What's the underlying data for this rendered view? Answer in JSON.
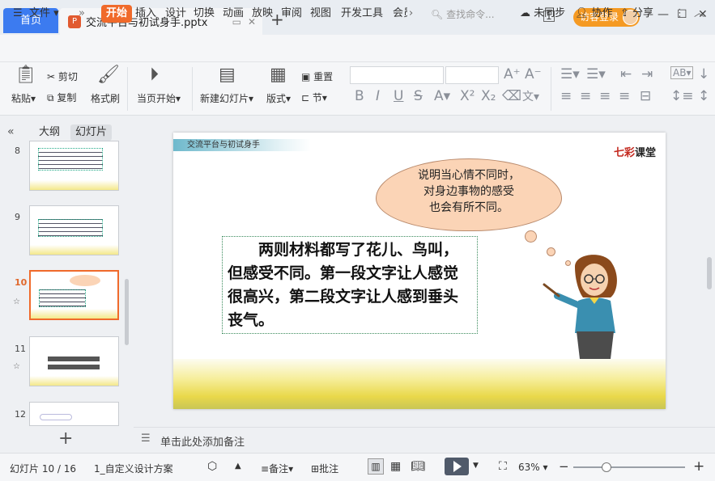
{
  "tabs": {
    "home": "首页",
    "doc": "交流平台与初试身手.pptx"
  },
  "account": {
    "visitor_login": "访客登录"
  },
  "menu": {
    "file": "文件",
    "items": [
      "开始",
      "插入",
      "设计",
      "切换",
      "动画",
      "放映",
      "审阅",
      "视图",
      "开发工具",
      "会员"
    ],
    "search": "查找命令...",
    "sync": "未同步",
    "collab": "协作",
    "share": "分享"
  },
  "ribbon": {
    "paste": "粘贴",
    "cut": "剪切",
    "copy": "复制",
    "format_painter": "格式刷",
    "play_from_current": "当页开始",
    "new_slide": "新建幻灯片",
    "layout": "版式",
    "reset": "重置",
    "section": "节"
  },
  "panel": {
    "outline": "大纲",
    "slides": "幻灯片",
    "numbers": [
      "8",
      "9",
      "10",
      "11",
      "12"
    ]
  },
  "slide": {
    "header": "交流平台与初试身手",
    "logo_a": "七彩",
    "logo_b": "课堂",
    "bubble": [
      "说明当心情不同时，",
      "对身边事物的感受",
      "也会有所不同。"
    ],
    "body": "　　两则材料都写了花儿、鸟叫，但感受不同。第一段文字让人感觉很高兴，第二段文字让人感到垂头丧气。"
  },
  "notes": {
    "placeholder": "单击此处添加备注"
  },
  "status": {
    "slide_pos": "幻灯片 10 / 16",
    "theme": "1_自定义设计方案",
    "notes": "备注",
    "comment": "批注",
    "zoom": "63%"
  }
}
